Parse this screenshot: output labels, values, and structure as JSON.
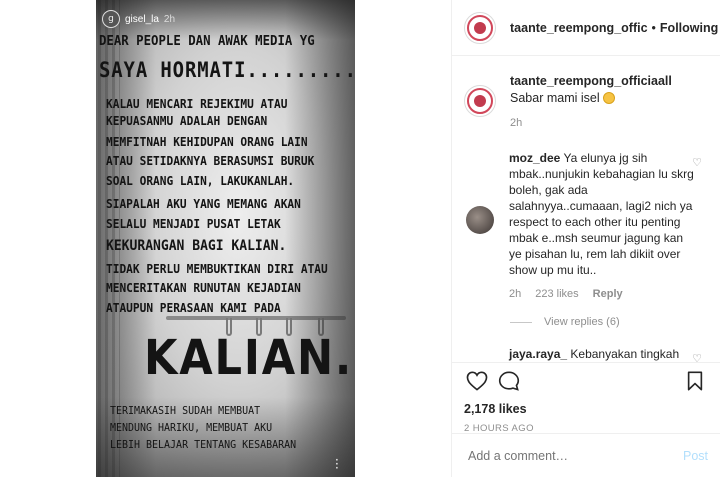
{
  "story": {
    "username": "gisel_la",
    "time": "2h",
    "avatar_initial": "g",
    "lines_header": [
      "DEAR PEOPLE DAN AWAK MEDIA YG"
    ],
    "headline": "SAYA HORMATI.........",
    "body_lines": [
      "KALAU MENCARI REJEKIMU ATAU",
      "KEPUASANMU ADALAH DENGAN",
      "MEMFITNAH KEHIDUPAN ORANG LAIN",
      "ATAU SETIDAKNYA BERASUMSI BURUK",
      "SOAL ORANG LAIN, LAKUKANLAH.",
      "SIAPALAH AKU YANG MEMANG AKAN",
      "SELALU MENJADI PUSAT LETAK",
      "KEKURANGAN BAGI KALIAN.",
      "TIDAK PERLU MEMBUKTIKAN DIRI ATAU",
      "MENCERITAKAN RUNUTAN KEJADIAN",
      "ATAUPUN PERASAAN KAMI PADA"
    ],
    "big_word": "KALIAN.",
    "closing_lines": [
      "TERIMAKASIH SUDAH MEMBUAT",
      "MENDUNG HARIKU, MEMBUAT AKU",
      "LEBIH BELAJAR TENTANG KESABARAN"
    ],
    "more_icon": "more-vertical-icon"
  },
  "header": {
    "username": "taante_reempong_offic",
    "separator": "•",
    "follow_label": "Following"
  },
  "caption": {
    "username": "taante_reempong_officiaall",
    "text": "Sabar mami isel",
    "emoji": "smiling-face-emoji",
    "time": "2h"
  },
  "comments": [
    {
      "username": "moz_dee",
      "text": "Ya elunya jg sih mbak..nunjukin kebahagian lu skrg boleh, gak ada salahnyya..cumaaan, lagi2 nich ya respect to each other itu penting mbak e..msh seumur jagung kan ye pisahan lu, rem lah dikiit over show up mu itu..",
      "time": "2h",
      "likes": "223 likes",
      "reply_label": "Reply",
      "view_replies": "View replies (6)"
    },
    {
      "username": "jaya.raya_",
      "text": "Kebanyakan tingkah sih Lo"
    }
  ],
  "actions": {
    "likes": "2,178 likes",
    "timestamp": "2 HOURS AGO"
  },
  "add_comment": {
    "placeholder": "Add a comment…",
    "post_label": "Post"
  },
  "colors": {
    "post_button": "#b2dffc",
    "meta_text": "#8e8e8e",
    "avatar_ring": "#d1475a"
  }
}
